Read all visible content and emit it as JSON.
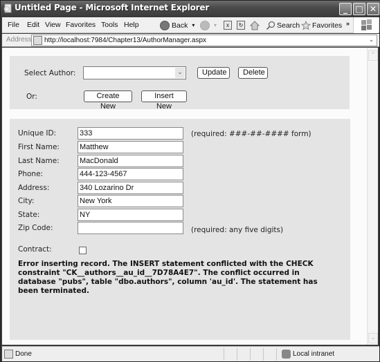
{
  "window": {
    "title": "Untitled Page - Microsoft Internet Explorer",
    "controls": {
      "minimize": "_",
      "maximize": "□",
      "close": "✕"
    }
  },
  "menubar": {
    "items": [
      "File",
      "Edit",
      "View",
      "Favorites",
      "Tools",
      "Help"
    ]
  },
  "toolbar": {
    "back_label": "Back",
    "back_dropdown": "▾",
    "forward_dropdown": "▾",
    "stop_glyph": "x",
    "refresh_glyph": "↻",
    "search_label": "Search",
    "favorites_label": "Favorites",
    "overflow_glyph": "»"
  },
  "addressbar": {
    "label": "Address",
    "url": "http://localhost:7984/Chapter13/AuthorManager.aspx",
    "dropdown_glyph": "⌄"
  },
  "selection_panel": {
    "select_author_label": "Select Author:",
    "select_author_value": "",
    "dropdown_glyph": "⌄",
    "update_label": "Update",
    "delete_label": "Delete",
    "or_label": "Or:",
    "create_new_label": "Create New",
    "insert_new_label": "Insert New"
  },
  "form": {
    "fields": [
      {
        "label": "Unique ID:",
        "value": "333",
        "hint": "(required: ###-##-#### form)"
      },
      {
        "label": "First Name:",
        "value": "Matthew",
        "hint": ""
      },
      {
        "label": "Last Name:",
        "value": "MacDonald",
        "hint": ""
      },
      {
        "label": "Phone:",
        "value": "444-123-4567",
        "hint": ""
      },
      {
        "label": "Address:",
        "value": "340 Lozarino Dr",
        "hint": ""
      },
      {
        "label": "City:",
        "value": "New York",
        "hint": ""
      },
      {
        "label": "State:",
        "value": "NY",
        "hint": ""
      },
      {
        "label": "Zip Code:",
        "value": "",
        "hint": "(required: any five digits)"
      }
    ],
    "contract_label": "Contract:",
    "contract_checked": false,
    "error_message": "Error inserting record. The INSERT statement conflicted with the CHECK constraint \"CK__authors__au_id__7D78A4E7\". The conflict occurred in database \"pubs\", table \"dbo.authors\", column 'au_id'. The statement has been terminated."
  },
  "scrollbar": {
    "up_glyph": "⌃",
    "down_glyph": "⌄"
  },
  "statusbar": {
    "status": "Done",
    "zone": "Local intranet"
  }
}
